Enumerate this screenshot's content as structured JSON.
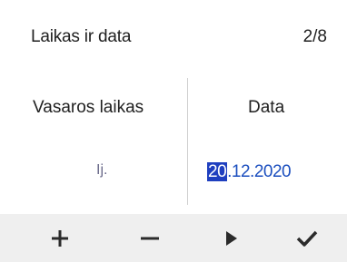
{
  "header": {
    "title": "Laikas ir data",
    "page": "2/8"
  },
  "left_column": {
    "label": "Vasaros laikas",
    "value": "Ij."
  },
  "right_column": {
    "label": "Data",
    "value_selected": "20",
    "value_rest": ".12.2020"
  },
  "toolbar": {
    "buttons": [
      {
        "icon": "plus-icon"
      },
      {
        "icon": "minus-icon"
      },
      {
        "icon": "play-icon"
      },
      {
        "icon": "check-icon"
      }
    ]
  },
  "colors": {
    "toolbar_bg": "#efefef",
    "selection_bg": "#1f3fbf",
    "value_blue": "#1c4fbf",
    "icon": "#2b2b2b"
  }
}
